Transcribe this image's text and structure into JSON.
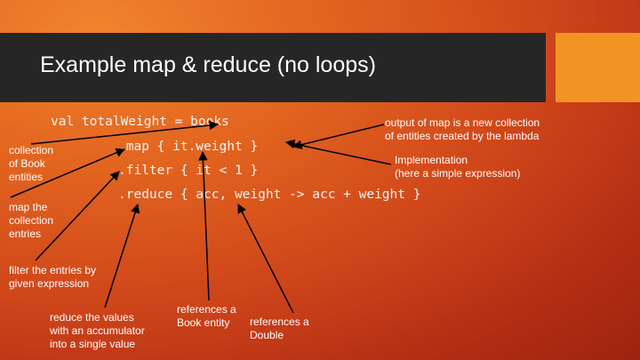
{
  "title": "Example map & reduce (no loops)",
  "code": {
    "line1": "val totalWeight = books",
    "line2": ".map { it.weight }",
    "line3": ".filter { it < 1 }",
    "line4": ".reduce { acc, weight -> acc + weight }"
  },
  "annotations": {
    "collection": "collection\nof Book\nentities",
    "map_entries": "map the\ncollection\nentries",
    "filter": "filter the entries by\ngiven expression",
    "reduce": "reduce the values\nwith an accumulator\ninto a single value",
    "book_entity": "references a\nBook entity",
    "double": "references a\nDouble",
    "output_map": "output of map is a new collection\nof entities created by the lambda",
    "implementation": "Implementation\n(here a simple expression)"
  },
  "colors": {
    "title_bar": "#262626",
    "accent": "#f29424",
    "background": "#d4521c"
  }
}
